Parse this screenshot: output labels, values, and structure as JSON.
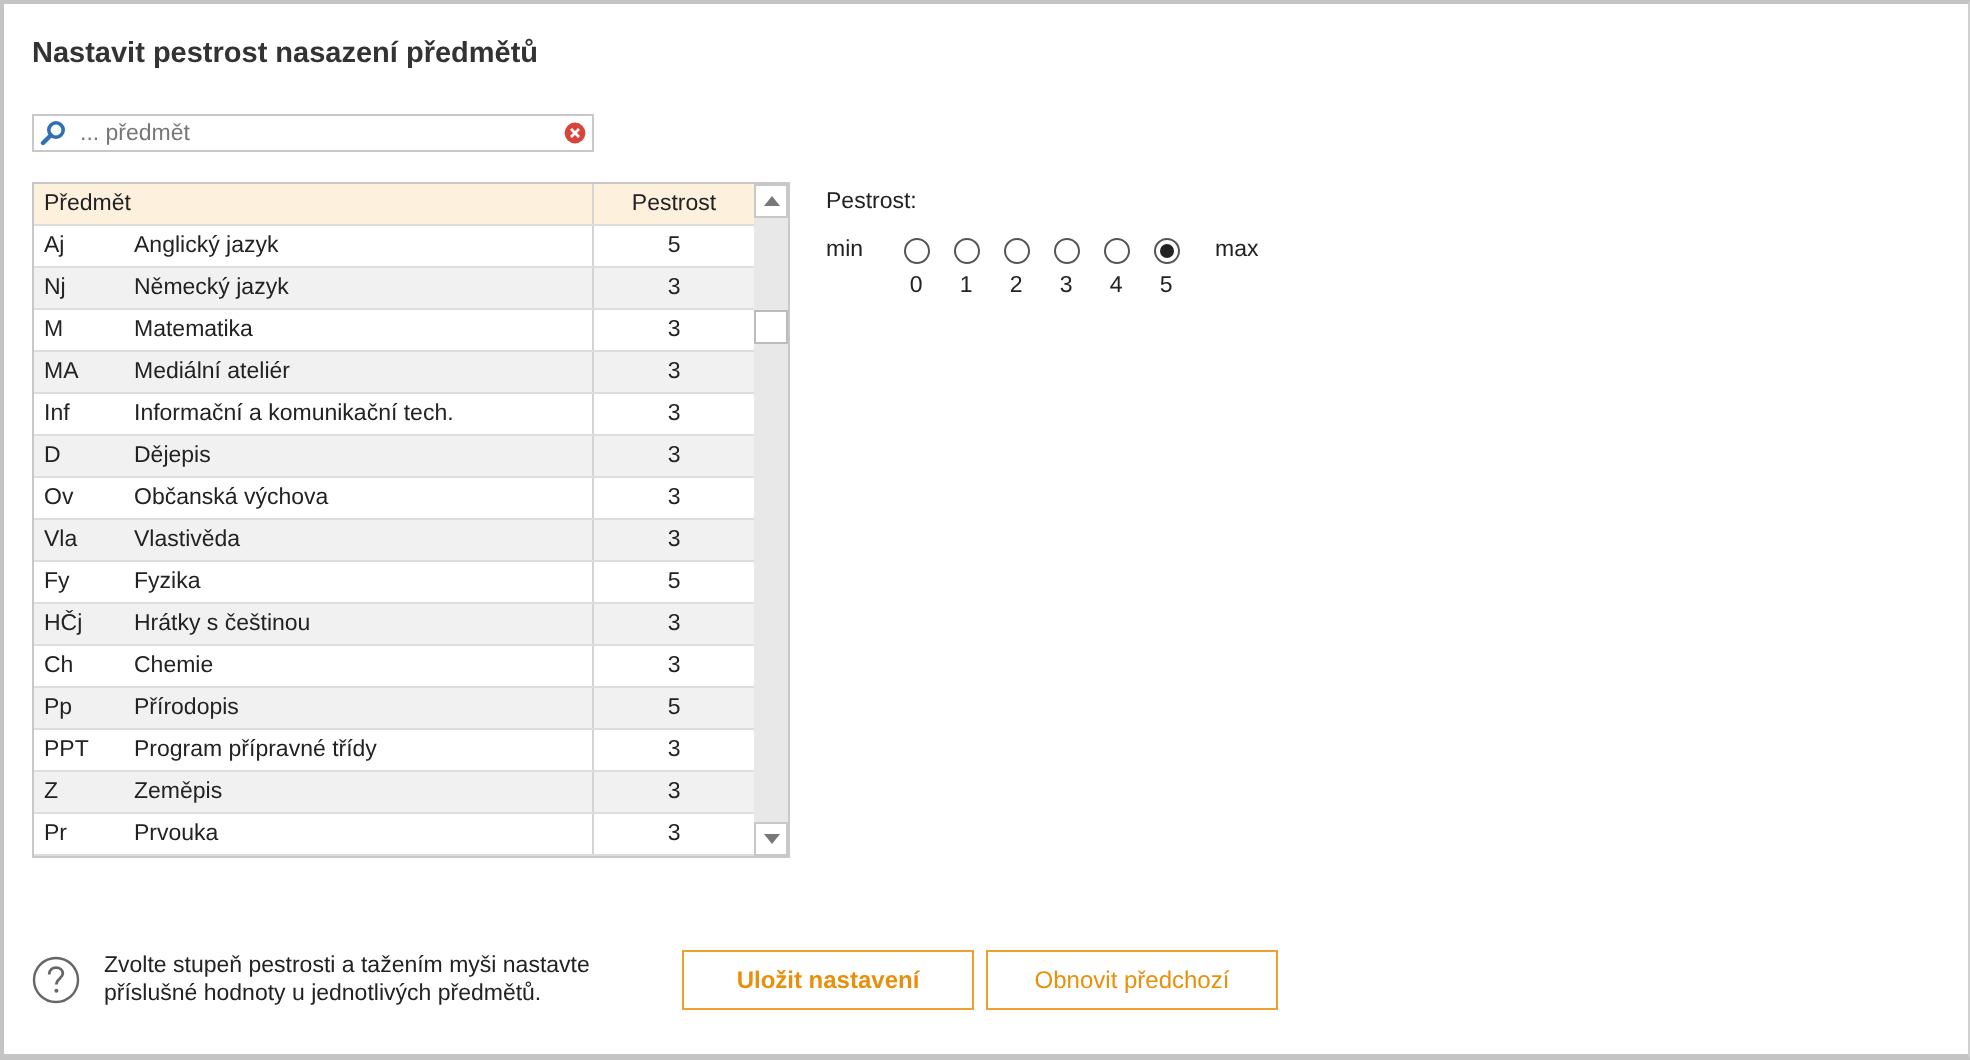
{
  "title": "Nastavit pestrost nasazení předmětů",
  "search": {
    "placeholder": "... předmět"
  },
  "table": {
    "columns": [
      "Předmět",
      "Pestrost"
    ],
    "rows": [
      {
        "code": "Aj",
        "name": "Anglický jazyk",
        "value": "5"
      },
      {
        "code": "Nj",
        "name": "Německý jazyk",
        "value": "3"
      },
      {
        "code": "M",
        "name": "Matematika",
        "value": "3"
      },
      {
        "code": "MA",
        "name": "Mediální ateliér",
        "value": "3"
      },
      {
        "code": "Inf",
        "name": "Informační a komunikační tech.",
        "value": "3"
      },
      {
        "code": "D",
        "name": "Dějepis",
        "value": "3"
      },
      {
        "code": "Ov",
        "name": "Občanská výchova",
        "value": "3"
      },
      {
        "code": "Vla",
        "name": "Vlastivěda",
        "value": "3"
      },
      {
        "code": "Fy",
        "name": "Fyzika",
        "value": "5"
      },
      {
        "code": "HČj",
        "name": "Hrátky s češtinou",
        "value": "3"
      },
      {
        "code": "Ch",
        "name": "Chemie",
        "value": "3"
      },
      {
        "code": "Pp",
        "name": "Přírodopis",
        "value": "5"
      },
      {
        "code": "PPT",
        "name": "Program přípravné třídy",
        "value": "3"
      },
      {
        "code": "Z",
        "name": "Zeměpis",
        "value": "3"
      },
      {
        "code": "Pr",
        "name": "Prvouka",
        "value": "3"
      }
    ]
  },
  "pestrost": {
    "label": "Pestrost:",
    "min": "min",
    "max": "max",
    "options": [
      {
        "label": "0",
        "selected": false
      },
      {
        "label": "1",
        "selected": false
      },
      {
        "label": "2",
        "selected": false
      },
      {
        "label": "3",
        "selected": false
      },
      {
        "label": "4",
        "selected": false
      },
      {
        "label": "5",
        "selected": true
      }
    ]
  },
  "hint": "Zvolte stupeň pestrosti a tažením myši nastavte příslušné hodnoty u jednotlivých předmětů.",
  "buttons": [
    {
      "label": "Uložit nastavení",
      "kind": "primary"
    },
    {
      "label": "Obnovit předchozí",
      "kind": "secondary"
    }
  ]
}
